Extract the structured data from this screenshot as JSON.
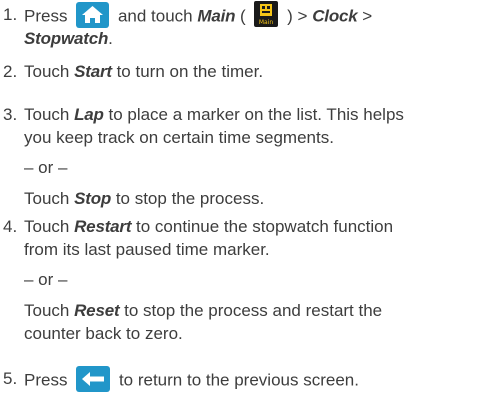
{
  "steps": [
    {
      "num": "1.",
      "l1_a": "Press",
      "l1_b": "and touch",
      "l1_main": "Main",
      "l1_c": "(",
      "l1_d": ") >",
      "l1_clock": "Clock",
      "l1_e": ">",
      "l2_stopwatch": "Stopwatch",
      "l2_end": "."
    },
    {
      "num": "2.",
      "a": "Touch",
      "start": "Start",
      "b": "to turn on the timer."
    },
    {
      "num": "3.",
      "a": "Touch",
      "lap": "Lap",
      "b": "to place a marker on the list. This helps",
      "line2": "you keep track on certain time segments.",
      "or": "– or –",
      "c": "Touch",
      "stop": "Stop",
      "d": "to stop the process."
    },
    {
      "num": "4.",
      "a": "Touch",
      "restart": "Restart",
      "b": "to continue the stopwatch function",
      "line2": "from its last paused time marker.",
      "or": "– or –",
      "c": "Touch",
      "reset": "Reset",
      "d": "to stop the process and restart the",
      "line4": "counter back to zero."
    },
    {
      "num": "5.",
      "a": "Press",
      "b": "to return to the previous screen."
    }
  ],
  "icons": {
    "home": "home-icon",
    "main": "main-menu-icon",
    "main_label": "Main",
    "back": "back-arrow-icon",
    "accent": "#2196c9",
    "main_bg": "#1a1a1a",
    "main_fg": "#f5c518"
  }
}
